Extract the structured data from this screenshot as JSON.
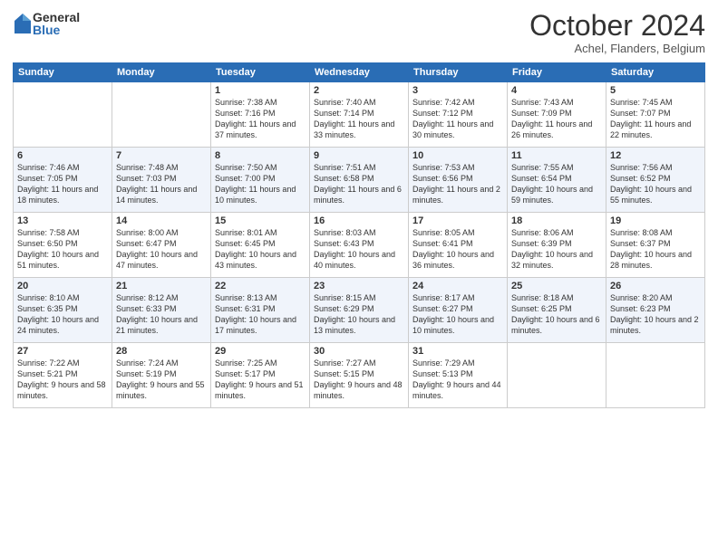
{
  "logo": {
    "general": "General",
    "blue": "Blue"
  },
  "title": "October 2024",
  "subtitle": "Achel, Flanders, Belgium",
  "headers": [
    "Sunday",
    "Monday",
    "Tuesday",
    "Wednesday",
    "Thursday",
    "Friday",
    "Saturday"
  ],
  "weeks": [
    [
      {
        "day": "",
        "content": ""
      },
      {
        "day": "",
        "content": ""
      },
      {
        "day": "1",
        "content": "Sunrise: 7:38 AM\nSunset: 7:16 PM\nDaylight: 11 hours and 37 minutes."
      },
      {
        "day": "2",
        "content": "Sunrise: 7:40 AM\nSunset: 7:14 PM\nDaylight: 11 hours and 33 minutes."
      },
      {
        "day": "3",
        "content": "Sunrise: 7:42 AM\nSunset: 7:12 PM\nDaylight: 11 hours and 30 minutes."
      },
      {
        "day": "4",
        "content": "Sunrise: 7:43 AM\nSunset: 7:09 PM\nDaylight: 11 hours and 26 minutes."
      },
      {
        "day": "5",
        "content": "Sunrise: 7:45 AM\nSunset: 7:07 PM\nDaylight: 11 hours and 22 minutes."
      }
    ],
    [
      {
        "day": "6",
        "content": "Sunrise: 7:46 AM\nSunset: 7:05 PM\nDaylight: 11 hours and 18 minutes."
      },
      {
        "day": "7",
        "content": "Sunrise: 7:48 AM\nSunset: 7:03 PM\nDaylight: 11 hours and 14 minutes."
      },
      {
        "day": "8",
        "content": "Sunrise: 7:50 AM\nSunset: 7:00 PM\nDaylight: 11 hours and 10 minutes."
      },
      {
        "day": "9",
        "content": "Sunrise: 7:51 AM\nSunset: 6:58 PM\nDaylight: 11 hours and 6 minutes."
      },
      {
        "day": "10",
        "content": "Sunrise: 7:53 AM\nSunset: 6:56 PM\nDaylight: 11 hours and 2 minutes."
      },
      {
        "day": "11",
        "content": "Sunrise: 7:55 AM\nSunset: 6:54 PM\nDaylight: 10 hours and 59 minutes."
      },
      {
        "day": "12",
        "content": "Sunrise: 7:56 AM\nSunset: 6:52 PM\nDaylight: 10 hours and 55 minutes."
      }
    ],
    [
      {
        "day": "13",
        "content": "Sunrise: 7:58 AM\nSunset: 6:50 PM\nDaylight: 10 hours and 51 minutes."
      },
      {
        "day": "14",
        "content": "Sunrise: 8:00 AM\nSunset: 6:47 PM\nDaylight: 10 hours and 47 minutes."
      },
      {
        "day": "15",
        "content": "Sunrise: 8:01 AM\nSunset: 6:45 PM\nDaylight: 10 hours and 43 minutes."
      },
      {
        "day": "16",
        "content": "Sunrise: 8:03 AM\nSunset: 6:43 PM\nDaylight: 10 hours and 40 minutes."
      },
      {
        "day": "17",
        "content": "Sunrise: 8:05 AM\nSunset: 6:41 PM\nDaylight: 10 hours and 36 minutes."
      },
      {
        "day": "18",
        "content": "Sunrise: 8:06 AM\nSunset: 6:39 PM\nDaylight: 10 hours and 32 minutes."
      },
      {
        "day": "19",
        "content": "Sunrise: 8:08 AM\nSunset: 6:37 PM\nDaylight: 10 hours and 28 minutes."
      }
    ],
    [
      {
        "day": "20",
        "content": "Sunrise: 8:10 AM\nSunset: 6:35 PM\nDaylight: 10 hours and 24 minutes."
      },
      {
        "day": "21",
        "content": "Sunrise: 8:12 AM\nSunset: 6:33 PM\nDaylight: 10 hours and 21 minutes."
      },
      {
        "day": "22",
        "content": "Sunrise: 8:13 AM\nSunset: 6:31 PM\nDaylight: 10 hours and 17 minutes."
      },
      {
        "day": "23",
        "content": "Sunrise: 8:15 AM\nSunset: 6:29 PM\nDaylight: 10 hours and 13 minutes."
      },
      {
        "day": "24",
        "content": "Sunrise: 8:17 AM\nSunset: 6:27 PM\nDaylight: 10 hours and 10 minutes."
      },
      {
        "day": "25",
        "content": "Sunrise: 8:18 AM\nSunset: 6:25 PM\nDaylight: 10 hours and 6 minutes."
      },
      {
        "day": "26",
        "content": "Sunrise: 8:20 AM\nSunset: 6:23 PM\nDaylight: 10 hours and 2 minutes."
      }
    ],
    [
      {
        "day": "27",
        "content": "Sunrise: 7:22 AM\nSunset: 5:21 PM\nDaylight: 9 hours and 58 minutes."
      },
      {
        "day": "28",
        "content": "Sunrise: 7:24 AM\nSunset: 5:19 PM\nDaylight: 9 hours and 55 minutes."
      },
      {
        "day": "29",
        "content": "Sunrise: 7:25 AM\nSunset: 5:17 PM\nDaylight: 9 hours and 51 minutes."
      },
      {
        "day": "30",
        "content": "Sunrise: 7:27 AM\nSunset: 5:15 PM\nDaylight: 9 hours and 48 minutes."
      },
      {
        "day": "31",
        "content": "Sunrise: 7:29 AM\nSunset: 5:13 PM\nDaylight: 9 hours and 44 minutes."
      },
      {
        "day": "",
        "content": ""
      },
      {
        "day": "",
        "content": ""
      }
    ]
  ]
}
